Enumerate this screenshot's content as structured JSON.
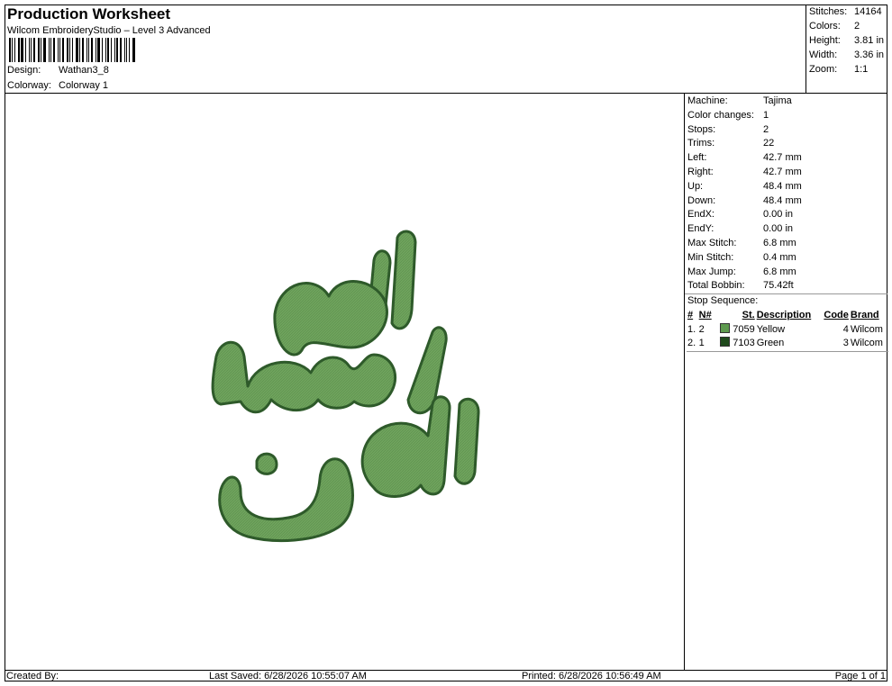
{
  "header": {
    "title": "Production Worksheet",
    "subtitle": "Wilcom EmbroideryStudio – Level 3 Advanced",
    "design_label": "Design:",
    "design_value": "Wathan3_8",
    "colorway_label": "Colorway:",
    "colorway_value": "Colorway 1"
  },
  "summary": [
    {
      "label": "Stitches:",
      "value": "14164"
    },
    {
      "label": "Colors:",
      "value": "2"
    },
    {
      "label": "Height:",
      "value": "3.81 in"
    },
    {
      "label": "Width:",
      "value": "3.36 in"
    },
    {
      "label": "Zoom:",
      "value": "1:1"
    }
  ],
  "properties": [
    {
      "label": "Machine:",
      "value": "Tajima"
    },
    {
      "label": "Color changes:",
      "value": "1"
    },
    {
      "label": "Stops:",
      "value": "2"
    },
    {
      "label": "Trims:",
      "value": "22"
    },
    {
      "label": "Left:",
      "value": "42.7 mm"
    },
    {
      "label": "Right:",
      "value": "42.7 mm"
    },
    {
      "label": "Up:",
      "value": "48.4 mm"
    },
    {
      "label": "Down:",
      "value": "48.4 mm"
    },
    {
      "label": "EndX:",
      "value": "0.00 in"
    },
    {
      "label": "EndY:",
      "value": "0.00 in"
    },
    {
      "label": "Max Stitch:",
      "value": "6.8 mm"
    },
    {
      "label": "Min Stitch:",
      "value": "0.4 mm"
    },
    {
      "label": "Max Jump:",
      "value": "6.8 mm"
    },
    {
      "label": "Total Bobbin:",
      "value": "75.42ft"
    }
  ],
  "stop_sequence": {
    "label": "Stop Sequence:",
    "headers": [
      "#",
      "N#",
      "St.",
      "Description",
      "Code",
      "Brand"
    ],
    "rows": [
      {
        "num": "1.",
        "n": "2",
        "color": "#5e9a4f",
        "st": "7059",
        "description": "Yellow",
        "code": "4",
        "brand": "Wilcom"
      },
      {
        "num": "2.",
        "n": "1",
        "color": "#1f4a1c",
        "st": "7103",
        "description": "Green",
        "code": "3",
        "brand": "Wilcom"
      }
    ]
  },
  "design": {
    "fill_color": "#6fa35d",
    "outline_color": "#2e5a2a"
  },
  "footer": {
    "created_by": "Created By:",
    "last_saved": "Last Saved: 6/28/2026 10:55:07 AM",
    "printed": "Printed: 6/28/2026 10:56:49 AM",
    "page": "Page 1 of 1"
  }
}
